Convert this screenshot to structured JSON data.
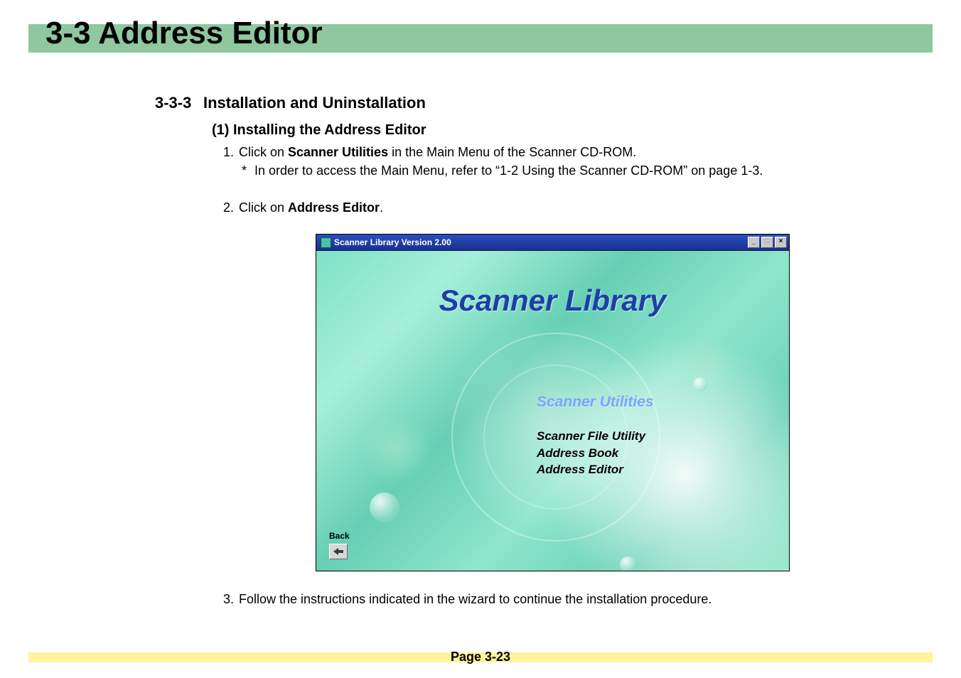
{
  "header": {
    "title": "3-3  Address Editor"
  },
  "section": {
    "num": "3-3-3",
    "title": "Installation and Uninstallation",
    "subsection_title": "(1) Installing the Address Editor",
    "steps": {
      "s1_prefix": "1. ",
      "s1_a": "Click on ",
      "s1_bold": "Scanner Utilities",
      "s1_b": " in the Main Menu of the Scanner CD-ROM.",
      "s1_note_star": "*",
      "s1_note": " In order to access the Main Menu, refer to “1-2 Using the Scanner CD-ROM” on page 1-3.",
      "s2_prefix": "2. ",
      "s2_a": "Click on ",
      "s2_bold": "Address Editor",
      "s2_b": ".",
      "s3_prefix": "3. ",
      "s3_text": "Follow the instructions indicated in the wizard to continue the installation procedure."
    }
  },
  "window": {
    "title": "Scanner Library  Version 2.00",
    "controls": {
      "min": "_",
      "max": "□",
      "close": "×"
    },
    "app_title": "Scanner Library",
    "menu_head": "Scanner Utilities",
    "menu_items": [
      "Scanner File Utility",
      "Address Book",
      "Address Editor"
    ],
    "back_label": "Back"
  },
  "footer": {
    "page_label": "Page 3-23"
  }
}
